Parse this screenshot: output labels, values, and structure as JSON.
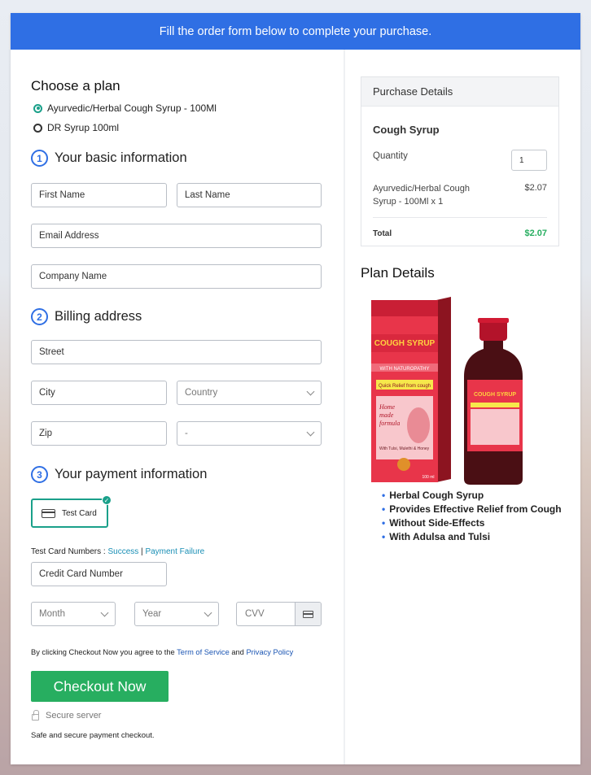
{
  "banner": "Fill the order form below to complete your purchase.",
  "plan": {
    "heading": "Choose a plan",
    "options": [
      {
        "label": "Ayurvedic/Herbal Cough Syrup - 100Ml",
        "selected": true
      },
      {
        "label": "DR Syrup 100ml",
        "selected": false
      }
    ]
  },
  "steps": {
    "basic": {
      "num": "1",
      "title": "Your basic information"
    },
    "billing": {
      "num": "2",
      "title": "Billing address"
    },
    "payment": {
      "num": "3",
      "title": "Your payment information"
    }
  },
  "basic_fields": {
    "first_name": "First Name",
    "last_name": "Last Name",
    "email": "Email Address",
    "company": "Company Name"
  },
  "billing_fields": {
    "street": "Street",
    "city": "City",
    "country": "Country",
    "zip": "Zip",
    "state": "-"
  },
  "payment": {
    "test_card_label": "Test Card",
    "test_numbers_prefix": "Test Card Numbers : ",
    "success_link": "Success",
    "separator": " | ",
    "failure_link": "Payment Failure",
    "card_number": "Credit Card Number",
    "month": "Month",
    "year": "Year",
    "cvv": "CVV"
  },
  "terms": {
    "prefix": "By clicking Checkout Now you agree to the ",
    "tos": "Term of Service",
    "and": " and ",
    "privacy": "Privacy Policy"
  },
  "checkout_label": "Checkout Now",
  "secure_server": "Secure server",
  "secure_note": "Safe and secure payment checkout.",
  "purchase": {
    "header": "Purchase Details",
    "product": "Cough Syrup",
    "quantity_label": "Quantity",
    "quantity_value": "1",
    "line_item_1": "Ayurvedic/Herbal Cough",
    "line_item_2": "Syrup - 100Ml x 1",
    "line_price": "$2.07",
    "total_label": "Total",
    "total_value": "$2.07"
  },
  "plan_details": {
    "heading": "Plan Details",
    "product_image": {
      "box_brand": "COUGH SYRUP",
      "box_tag": "WITH NATUROPATHY",
      "box_relief": "Quick Relief from cough",
      "box_formula_1": "Home",
      "box_formula_2": "made",
      "box_formula_3": "formula",
      "box_ingredients": "With Tulsi, Mulethi & Honey",
      "box_volume": "100 ml",
      "bottle_brand": "COUGH SYRUP"
    },
    "features": [
      "Herbal Cough Syrup",
      "Provides Effective Relief from Cough",
      "Without Side-Effects",
      "With Adulsa and Tulsi"
    ]
  },
  "colors": {
    "banner": "#2f6fe4",
    "accent_green": "#27ae60",
    "selection_teal": "#1aa08a",
    "total_green": "#27ae60",
    "link_blue": "#1a8fb5"
  }
}
